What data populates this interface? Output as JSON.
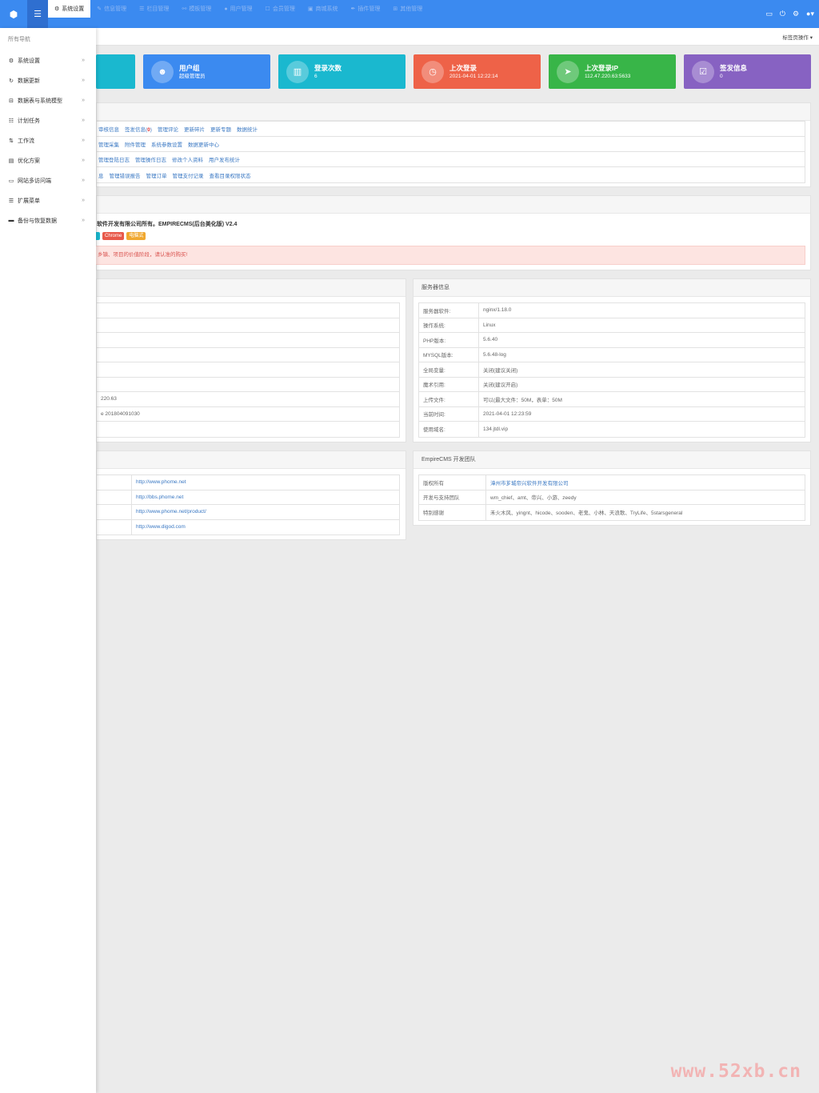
{
  "topbar": {
    "nav": [
      {
        "icon": "gear-icon",
        "glyph": "⚙",
        "label": "系统设置",
        "active": true
      },
      {
        "icon": "edit-icon",
        "glyph": "✎",
        "label": "信息管理",
        "active": false
      },
      {
        "icon": "list-icon",
        "glyph": "☰",
        "label": "栏目管理",
        "active": false
      },
      {
        "icon": "template-icon",
        "glyph": "⚯",
        "label": "模板管理",
        "active": false
      },
      {
        "icon": "user-icon",
        "glyph": "●",
        "label": "用户管理",
        "active": false
      },
      {
        "icon": "member-icon",
        "glyph": "☐",
        "label": "会员管理",
        "active": false
      },
      {
        "icon": "shop-icon",
        "glyph": "▣",
        "label": "商城系统",
        "active": false
      },
      {
        "icon": "wrench-icon",
        "glyph": "✒",
        "label": "插件管理",
        "active": false
      },
      {
        "icon": "other-icon",
        "glyph": "⊞",
        "label": "其他管理",
        "active": false
      }
    ]
  },
  "sidebar": {
    "title": "所有导航",
    "items": [
      {
        "icon": "gear-icon",
        "glyph": "⚙",
        "label": "系统设置"
      },
      {
        "icon": "refresh-icon",
        "glyph": "↻",
        "label": "数据更新"
      },
      {
        "icon": "database-icon",
        "glyph": "⊟",
        "label": "数据表与系统模型"
      },
      {
        "icon": "task-list-icon",
        "glyph": "☷",
        "label": "计划任务"
      },
      {
        "icon": "sort-icon",
        "glyph": "⇅",
        "label": "工作流"
      },
      {
        "icon": "book-icon",
        "glyph": "▤",
        "label": "优化方案"
      },
      {
        "icon": "laptop-icon",
        "glyph": "▭",
        "label": "网站多访问端"
      },
      {
        "icon": "menu-icon",
        "glyph": "☰",
        "label": "扩展菜单"
      },
      {
        "icon": "backup-icon",
        "glyph": "▬",
        "label": "备份与恢复数据"
      }
    ]
  },
  "tabbar": {
    "ops": "标签页操作 ▾"
  },
  "stats": [
    {
      "title": "",
      "sub": "",
      "color": "#1ab8cf",
      "icon": "person-icon",
      "glyph": ""
    },
    {
      "title": "用户组",
      "sub": "超级管理员",
      "color": "#3b8af0",
      "icon": "users-icon",
      "glyph": "☻"
    },
    {
      "title": "登录次数",
      "sub": "6",
      "color": "#1ab8cf",
      "icon": "chart-icon",
      "glyph": "▥"
    },
    {
      "title": "上次登录",
      "sub": "2021-04-01 12:22:14",
      "color": "#ee6248",
      "icon": "clock-icon",
      "glyph": "◷"
    },
    {
      "title": "上次登录IP",
      "sub": "112.47.220.63:5633",
      "color": "#38b548",
      "icon": "location-arrow-icon",
      "glyph": "➤"
    },
    {
      "title": "签发信息",
      "sub": "0",
      "color": "#8762c2",
      "icon": "check-square-icon",
      "glyph": "☑"
    }
  ],
  "links": [
    [
      {
        "text": "审核信息"
      },
      {
        "text": "签发信息(",
        "red": "0",
        "after": ")"
      },
      {
        "text": "管理评论"
      },
      {
        "text": "更新碎片"
      },
      {
        "text": "更新专题"
      },
      {
        "text": "数据统计"
      }
    ],
    [
      {
        "text": "管理采集"
      },
      {
        "text": "附件管理"
      },
      {
        "text": "系统参数设置"
      },
      {
        "text": "数据更新中心"
      }
    ],
    [
      {
        "text": "管理登陆日志"
      },
      {
        "text": "管理操作日志"
      },
      {
        "text": "修改个人资料"
      },
      {
        "text": "用户发布统计"
      }
    ],
    [
      {
        "text": "息"
      },
      {
        "text": "管理错误报告"
      },
      {
        "text": "管理订单"
      },
      {
        "text": "管理支付记录"
      },
      {
        "text": "查看目录权限状态"
      }
    ]
  ],
  "version": {
    "text": "软件开发有限公司所有。EMPIRECMS(后台美化版) V2.4",
    "badges": [
      {
        "label": "",
        "color": "#1ab8cf"
      },
      {
        "label": "Chrome",
        "color": "#e8594a"
      },
      {
        "label": "电脑式",
        "color": "#f0a830"
      }
    ],
    "alert": "乡镇、项目的价值阶段，请认准的购买!"
  },
  "left_info": {
    "rows": [
      "",
      "",
      "",
      "",
      "",
      "",
      "220.63",
      "e 201804091030",
      ""
    ]
  },
  "server": {
    "title": "服务器信息",
    "rows": [
      {
        "k": "服务器软件:",
        "v": "nginx/1.18.0"
      },
      {
        "k": "操作系统:",
        "v": "Linux"
      },
      {
        "k": "PHP版本:",
        "v": "5.6.40"
      },
      {
        "k": "MYSQL版本:",
        "v": "5.6.48-log"
      },
      {
        "k": "全局变量:",
        "v": "关闭(建议关闭)"
      },
      {
        "k": "魔术引用:",
        "v": "关闭(建议开启)"
      },
      {
        "k": "上传文件:",
        "v": "可以(最大文件：50M，表单：50M"
      },
      {
        "k": "当前时间:",
        "v": "2021-04-01 12:23:59"
      },
      {
        "k": "使用域名:",
        "v": "134.jtdl.vip"
      }
    ]
  },
  "official": {
    "rows": [
      "http://www.phome.net",
      "http://bbs.phome.net",
      "http://www.phome.net/product/",
      "http://www.digod.com"
    ]
  },
  "team": {
    "title": "EmpireCMS 开发团队",
    "rows": [
      {
        "k": "版权所有",
        "v": "漳州市芗城帝兴软件开发有限公司",
        "link": true
      },
      {
        "k": "开发与支持团队",
        "v": "wm_chief、amt、帝兴、小游、zeedy",
        "link": false
      },
      {
        "k": "特别感谢",
        "v": "禾火木风、yingnt、hicode、sooden、老鬼、小林、天浪歌、TryLife、5starsgeneral",
        "link": false
      }
    ]
  },
  "watermark": "www.52xb.cn"
}
